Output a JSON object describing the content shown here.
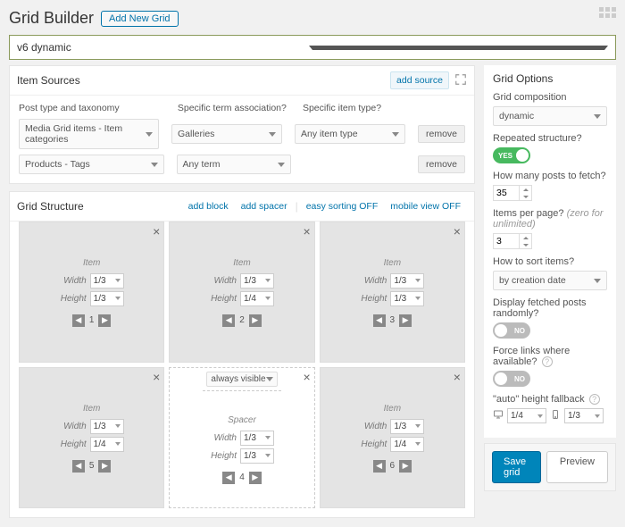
{
  "header": {
    "title": "Grid Builder",
    "add_new_label": "Add New Grid"
  },
  "top_select": {
    "value": "v6 dynamic"
  },
  "item_sources": {
    "title": "Item Sources",
    "add_source_label": "add source",
    "col_post": "Post type and taxonomy",
    "col_term": "Specific term association?",
    "col_type": "Specific item type?",
    "rows": [
      {
        "post": "Media Grid items - Item categories",
        "term": "Galleries",
        "type": "Any item type",
        "remove": "remove"
      },
      {
        "post": "Products - Tags",
        "term": "Any term",
        "type": "",
        "remove": "remove"
      }
    ]
  },
  "grid_structure": {
    "title": "Grid Structure",
    "add_block": "add block",
    "add_spacer": "add spacer",
    "easy_sort": "easy sorting OFF",
    "mobile_view": "mobile view OFF",
    "item_label": "Item",
    "width_label": "Width",
    "height_label": "Height",
    "spacer_label": "Spacer",
    "always_visible": "always visible",
    "blocks": [
      {
        "w": "1/3",
        "h": "1/3",
        "i": "1"
      },
      {
        "w": "1/3",
        "h": "1/4",
        "i": "2"
      },
      {
        "w": "1/3",
        "h": "1/3",
        "i": "3"
      },
      {
        "w": "1/3",
        "h": "1/4",
        "i": "5"
      },
      {
        "w": "1/3",
        "h": "1/3",
        "i": "4",
        "spacer": true
      },
      {
        "w": "1/3",
        "h": "1/4",
        "i": "6"
      }
    ]
  },
  "grid_options": {
    "title": "Grid Options",
    "composition_label": "Grid composition",
    "composition_value": "dynamic",
    "repeated_label": "Repeated structure?",
    "repeated_on": true,
    "posts_label": "How many posts to fetch?",
    "posts_value": "35",
    "per_page_label": "Items per page?",
    "per_page_hint": "(zero for unlimited)",
    "per_page_value": "3",
    "sort_label": "How to sort items?",
    "sort_value": "by creation date",
    "random_label": "Display fetched posts randomly?",
    "force_links_label": "Force links where available?",
    "auto_height_label": "\"auto\" height fallback",
    "auto_desktop": "1/4",
    "auto_mobile": "1/3",
    "yes": "YES",
    "no": "NO"
  },
  "actions": {
    "save": "Save grid",
    "preview": "Preview"
  }
}
